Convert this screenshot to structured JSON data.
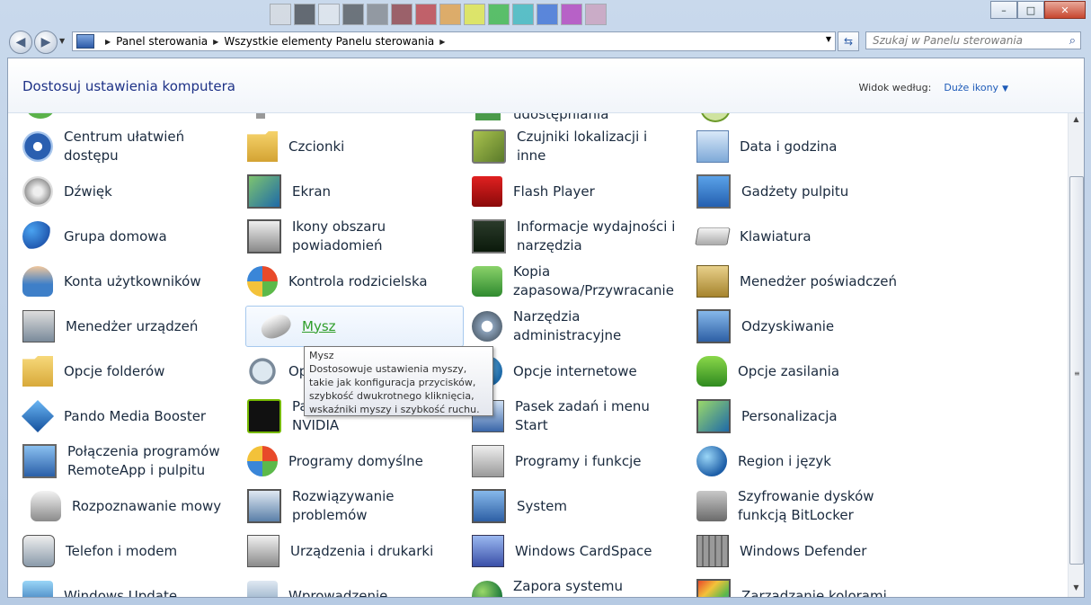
{
  "window": {
    "controls": {
      "minimize": "–",
      "maximize": "□",
      "close": "✕"
    }
  },
  "addressbar": {
    "crumbs": [
      "Panel sterowania",
      "Wszystkie elementy Panelu sterowania"
    ],
    "search_placeholder": "Szukaj w Panelu sterowania"
  },
  "header": {
    "title": "Dostosuj ustawienia komputera",
    "view_label": "Widok według:",
    "view_value": "Duże ikony"
  },
  "partial_top": {
    "col3_label": "udostępniania"
  },
  "items": [
    {
      "label": "Centrum ułatwień dostępu",
      "icon": "ease-of-access-icon"
    },
    {
      "label": "Czcionki",
      "icon": "fonts-icon"
    },
    {
      "label": "Czujniki lokalizacji i inne",
      "icon": "location-sensors-icon"
    },
    {
      "label": "Data i godzina",
      "icon": "date-time-icon"
    },
    {
      "label": "Dźwięk",
      "icon": "sound-icon"
    },
    {
      "label": "Ekran",
      "icon": "display-icon"
    },
    {
      "label": "Flash Player",
      "icon": "flash-player-icon"
    },
    {
      "label": "Gadżety pulpitu",
      "icon": "desktop-gadgets-icon"
    },
    {
      "label": "Grupa domowa",
      "icon": "homegroup-icon"
    },
    {
      "label": "Ikony obszaru powiadomień",
      "icon": "notification-area-icon"
    },
    {
      "label": "Informacje wydajności i narzędzia",
      "icon": "performance-icon"
    },
    {
      "label": "Klawiatura",
      "icon": "keyboard-icon"
    },
    {
      "label": "Konta użytkowników",
      "icon": "user-accounts-icon"
    },
    {
      "label": "Kontrola rodzicielska",
      "icon": "parental-controls-icon"
    },
    {
      "label": "Kopia zapasowa/Przywracanie",
      "icon": "backup-restore-icon"
    },
    {
      "label": "Menedżer poświadczeń",
      "icon": "credential-manager-icon"
    },
    {
      "label": "Menedżer urządzeń",
      "icon": "device-manager-icon"
    },
    {
      "label": "Mysz",
      "icon": "mouse-icon"
    },
    {
      "label": "Narzędzia administracyjne",
      "icon": "admin-tools-icon"
    },
    {
      "label": "Odzyskiwanie",
      "icon": "recovery-icon"
    },
    {
      "label": "Opcje folderów",
      "icon": "folder-options-icon"
    },
    {
      "label": "Opcje indeksowania",
      "icon": "indexing-options-icon"
    },
    {
      "label": "Opcje internetowe",
      "icon": "internet-options-icon"
    },
    {
      "label": "Opcje zasilania",
      "icon": "power-options-icon"
    },
    {
      "label": "Pando Media Booster",
      "icon": "pando-icon"
    },
    {
      "label": "Panel sterowania NVIDIA",
      "icon": "nvidia-icon"
    },
    {
      "label": "Pasek zadań i menu Start",
      "icon": "taskbar-icon"
    },
    {
      "label": "Personalizacja",
      "icon": "personalization-icon"
    },
    {
      "label": "Połączenia programów RemoteApp i pulpitu",
      "icon": "remoteapp-icon"
    },
    {
      "label": "Programy domyślne",
      "icon": "default-programs-icon"
    },
    {
      "label": "Programy i funkcje",
      "icon": "programs-features-icon"
    },
    {
      "label": "Region i język",
      "icon": "region-language-icon"
    },
    {
      "label": "Rozpoznawanie mowy",
      "icon": "speech-recognition-icon"
    },
    {
      "label": "Rozwiązywanie problemów",
      "icon": "troubleshooting-icon"
    },
    {
      "label": "System",
      "icon": "system-icon"
    },
    {
      "label": "Szyfrowanie dysków funkcją BitLocker",
      "icon": "bitlocker-icon"
    },
    {
      "label": "Telefon i modem",
      "icon": "phone-modem-icon"
    },
    {
      "label": "Urządzenia i drukarki",
      "icon": "devices-printers-icon"
    },
    {
      "label": "Windows CardSpace",
      "icon": "cardspace-icon"
    },
    {
      "label": "Windows Defender",
      "icon": "defender-icon"
    },
    {
      "label": "Windows Update",
      "icon": "windows-update-icon"
    },
    {
      "label": "Wprowadzenie",
      "icon": "getting-started-icon"
    },
    {
      "label": "Zapora systemu Windows",
      "icon": "firewall-icon"
    },
    {
      "label": "Zarządzanie kolorami",
      "icon": "color-management-icon"
    }
  ],
  "tooltip": {
    "title": "Mysz",
    "body": "Dostosowuje ustawienia myszy, takie jak konfiguracja przycisków, szybkość dwukrotnego kliknięcia, wskaźniki myszy i szybkość ruchu."
  },
  "colors": {
    "title": "#1e3287",
    "link": "#1e5bb8",
    "hover_label": "#2f9e2a"
  }
}
